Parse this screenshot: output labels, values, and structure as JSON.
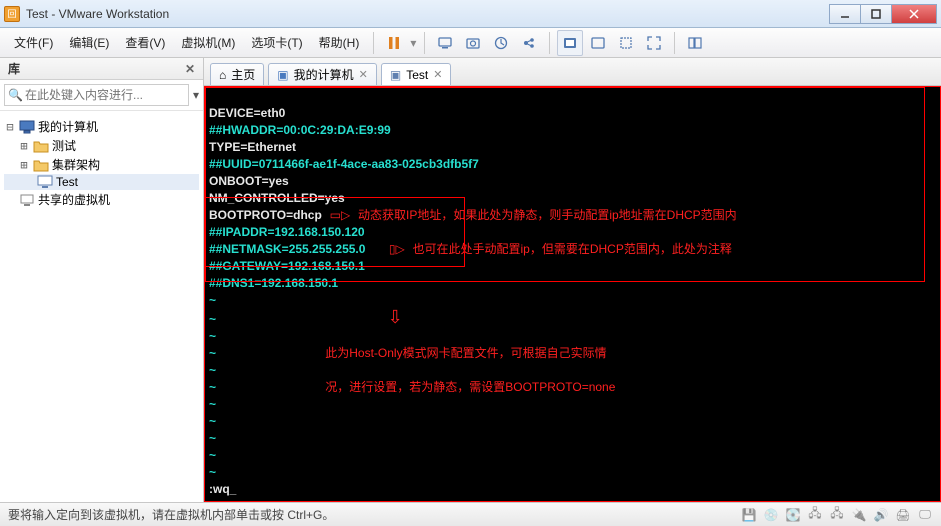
{
  "title": "Test - VMware Workstation",
  "menu": {
    "file": "文件(F)",
    "edit": "编辑(E)",
    "view": "查看(V)",
    "vm": "虚拟机(M)",
    "tabs": "选项卡(T)",
    "help": "帮助(H)"
  },
  "sidebar": {
    "header": "库",
    "search_placeholder": "在此处键入内容进行...",
    "items": {
      "root": "我的计算机",
      "a": "测试",
      "b": "集群架构",
      "c": "Test",
      "shared": "共享的虚拟机"
    }
  },
  "tabs": {
    "home": "主页",
    "mycomp": "我的计算机",
    "test": "Test"
  },
  "term": {
    "l1": "DEVICE=eth0",
    "l2": "##HWADDR=00:0C:29:DA:E9:99",
    "l3": "TYPE=Ethernet",
    "l4": "##UUID=0711466f-ae1f-4ace-aa83-025cb3dfb5f7",
    "l5": "ONBOOT=yes",
    "l6": "NM_CONTROLLED=yes",
    "l7": "BOOTPROTO=dhcp",
    "l8": "##IPADDR=192.168.150.120",
    "l9": "##NETMASK=255.255.255.0",
    "l10": "##GATEWAY=192.168.150.1",
    "l11": "##DNS1=192.168.150.1",
    "wq": ":wq_"
  },
  "ann": {
    "a1": "动态获取IP地址，如果此处为静态，则手动配置ip地址需在DHCP范围内",
    "a2": "也可在此处手动配置ip，但需要在DHCP范围内，此处为注释",
    "a3a": "此为Host-Only模式网卡配置文件，可根据自己实际情",
    "a3b": "况，进行设置，若为静态，需设置BOOTPROTO=none"
  },
  "status": "要将输入定向到该虚拟机，请在虚拟机内部单击或按 Ctrl+G。"
}
